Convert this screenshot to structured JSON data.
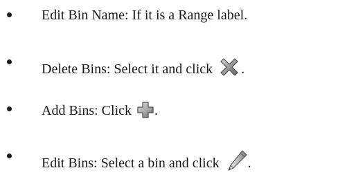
{
  "items": [
    {
      "text": "Edit Bin Name: If it is a Range label."
    },
    {
      "text": "Delete Bins: Select it and click",
      "icon": "delete-x-icon",
      "suffix": "."
    },
    {
      "text": "Add Bins: Click",
      "icon": "add-plus-icon",
      "suffix": "."
    },
    {
      "text": "Edit Bins: Select a bin and click",
      "icon": "edit-pencil-icon",
      "suffix": "."
    }
  ]
}
